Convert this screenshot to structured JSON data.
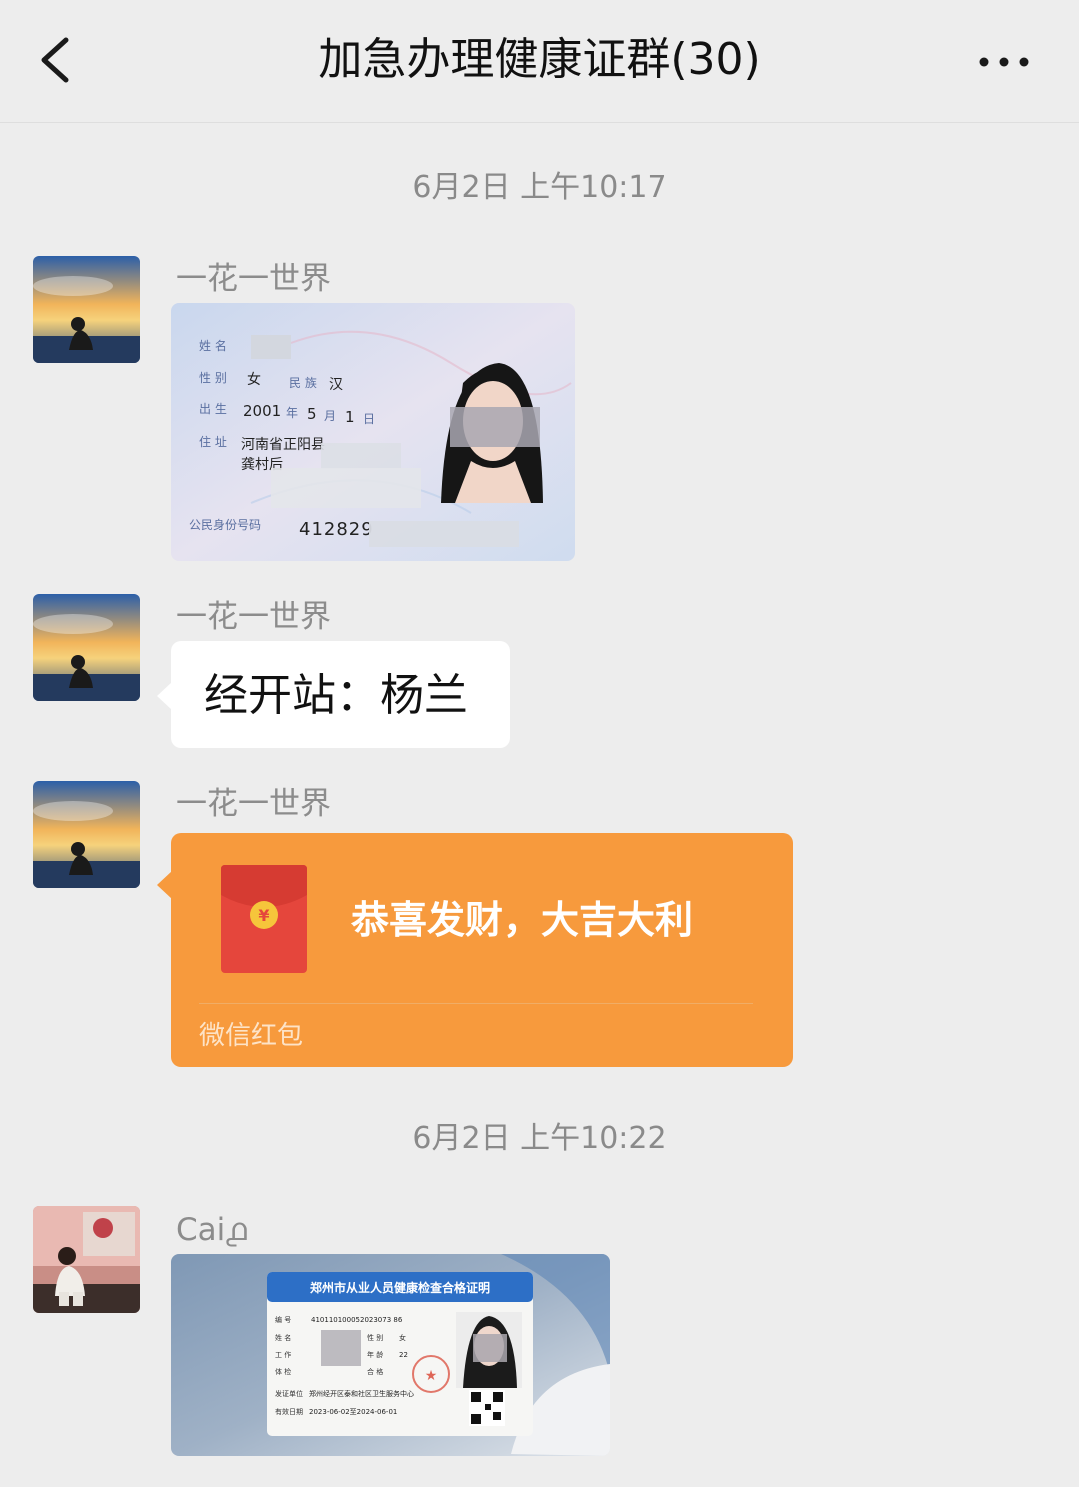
{
  "header": {
    "title": "加急办理健康证群(30)",
    "back_icon": "chevron-left-icon",
    "more_icon": "more-dots-icon"
  },
  "timestamps": [
    "6月2日 上午10:17",
    "6月2日 上午10:22"
  ],
  "messages": [
    {
      "sender": "一花一世界",
      "type": "image",
      "image_content": {
        "name_label": "姓 名",
        "sex_label": "性 别",
        "sex_value": "女",
        "ethnic_label": "民 族",
        "ethnic_value": "汉",
        "birth_label": "出 生",
        "birth_year": "2001",
        "year_char": "年",
        "birth_month": "5",
        "month_char": "月",
        "birth_day": "1",
        "day_char": "日",
        "address_label": "住 址",
        "address_line1": "河南省正阳县",
        "address_line2": "龚村后",
        "id_label": "公民身份号码",
        "id_number": "412829"
      }
    },
    {
      "sender": "一花一世界",
      "type": "text",
      "text": "经开站：杨兰"
    },
    {
      "sender": "一花一世界",
      "type": "red_packet",
      "greeting": "恭喜发财，大吉大利",
      "label": "微信红包",
      "icon": "red-envelope-icon",
      "symbol": "¥"
    },
    {
      "sender": "Cai൧",
      "type": "image",
      "image_content": {
        "card_title": "郑州市从业人员健康检查合格证明",
        "number_label": "编 号",
        "number_value": "410110100052023073 86",
        "name_label": "姓 名",
        "sex_label": "性 别",
        "sex_value": "女",
        "work_label": "工 作",
        "age_label": "年 龄",
        "age_value": "22",
        "exam_label": "体 检",
        "result_label": "合 格",
        "issuer_label": "发证单位",
        "issuer_value": "郑州经开区泰和社区卫生服务中心",
        "valid_label": "有效日期",
        "valid_value": "2023-06-02至2024-06-01"
      }
    }
  ],
  "colors": {
    "background": "#ededed",
    "bubble": "#ffffff",
    "red_packet": "#f79a3d",
    "envelope": "#e5463c",
    "coin": "#f6c53b"
  }
}
